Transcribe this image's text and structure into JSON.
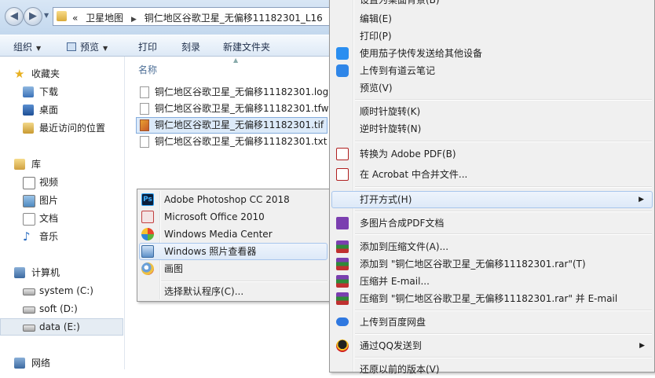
{
  "window": {
    "address": {
      "prefix": "«",
      "parts": [
        "卫星地图",
        "铜仁地区谷歌卫星_无偏移11182301_L16"
      ]
    }
  },
  "toolbar": {
    "organize": "组织",
    "preview": "预览",
    "print": "打印",
    "burn": "刻录",
    "new_folder": "新建文件夹"
  },
  "nav": {
    "favorites": "收藏夹",
    "downloads": "下载",
    "desktop": "桌面",
    "recent": "最近访问的位置",
    "libraries": "库",
    "videos": "视频",
    "pictures": "图片",
    "documents": "文档",
    "music": "音乐",
    "computer": "计算机",
    "drive_c": "system (C:)",
    "drive_d": "soft (D:)",
    "drive_e": "data (E:)",
    "network": "网络"
  },
  "files": {
    "column_name": "名称",
    "items": [
      "铜仁地区谷歌卫星_无偏移11182301.log",
      "铜仁地区谷歌卫星_无偏移11182301.tfw",
      "铜仁地区谷歌卫星_无偏移11182301.tif",
      "铜仁地区谷歌卫星_无偏移11182301.txt"
    ]
  },
  "open_with": {
    "items": [
      "Adobe Photoshop CC 2018",
      "Microsoft Office 2010",
      "Windows Media Center",
      "Windows 照片查看器",
      "画图"
    ],
    "choose_default": "选择默认程序(C)..."
  },
  "context_menu": {
    "set_background": "设置为桌面背景(B)",
    "edit": "编辑(E)",
    "print": "打印(P)",
    "send_qiezi": "使用茄子快传发送给其他设备",
    "youdao": "上传到有道云笔记",
    "preview": "预览(V)",
    "rotate_cw": "顺时针旋转(K)",
    "rotate_ccw": "逆时针旋转(N)",
    "to_pdf": "转换为 Adobe PDF(B)",
    "acrobat_merge": "在 Acrobat 中合并文件...",
    "open_with": "打开方式(H)",
    "multi_pdf": "多图片合成PDF文档",
    "add_archive": "添加到压缩文件(A)...",
    "add_rar": "添加到 \"铜仁地区谷歌卫星_无偏移11182301.rar\"(T)",
    "compress_email": "压缩并 E-mail...",
    "compress_rar_email": "压缩到 \"铜仁地区谷歌卫星_无偏移11182301.rar\" 并 E-mail",
    "baidu": "上传到百度网盘",
    "qq_send": "通过QQ发送到",
    "restore_prev": "还原以前的版本(V)"
  },
  "icons": {
    "submenu_arrow": "right-triangle-icon",
    "dropdown_arrow": "down-triangle-icon"
  }
}
